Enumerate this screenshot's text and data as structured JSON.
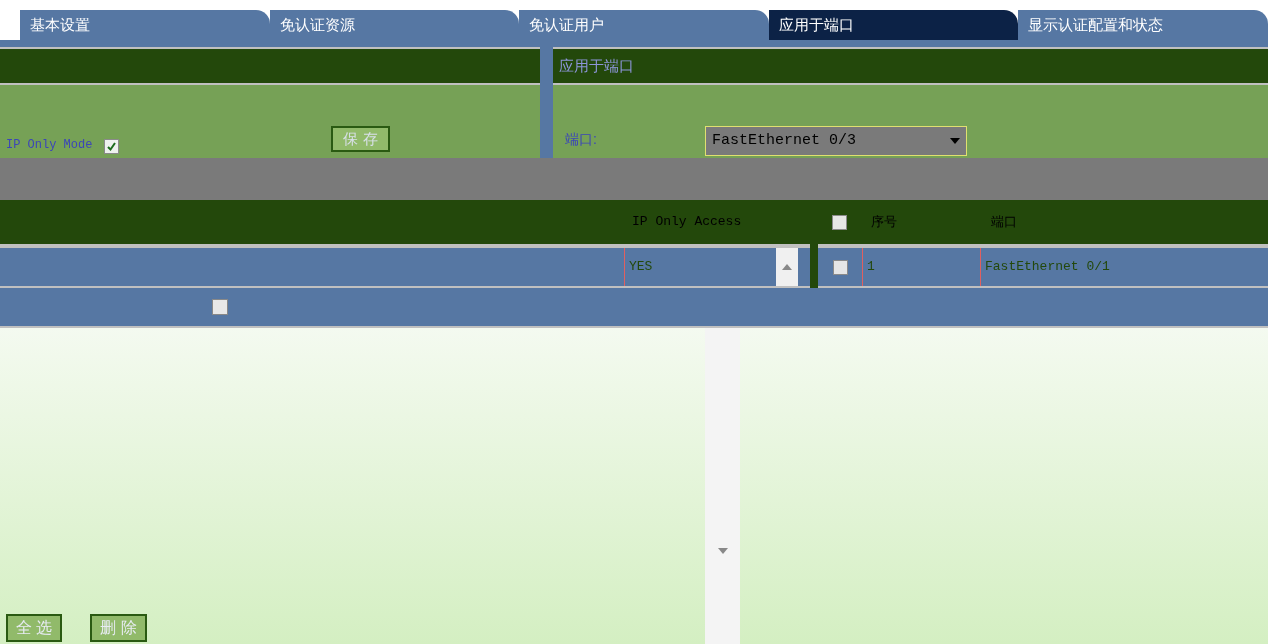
{
  "tabs": [
    {
      "label": "基本设置",
      "selected": false
    },
    {
      "label": "免认证资源",
      "selected": false
    },
    {
      "label": "免认证用户",
      "selected": false
    },
    {
      "label": "应用于端口",
      "selected": true
    },
    {
      "label": "显示认证配置和状态",
      "selected": false
    }
  ],
  "settings": {
    "mode_label": "IP Only Mode",
    "mode_checked": true,
    "save": "保 存"
  },
  "port_panel": {
    "title": "应用于端口",
    "port_label": "端口:",
    "port_value": "FastEthernet 0/3"
  },
  "left_table": {
    "columns": [
      "IP Only Access"
    ],
    "rows": [
      {
        "cells": [
          "YES"
        ]
      }
    ]
  },
  "right_table": {
    "columns": [
      "序号",
      "端口"
    ],
    "header_checked": false,
    "rows": [
      {
        "checked": false,
        "cells": [
          "1",
          "FastEthernet 0/1"
        ]
      }
    ]
  },
  "buttons": [
    "全 选",
    "删 除"
  ]
}
